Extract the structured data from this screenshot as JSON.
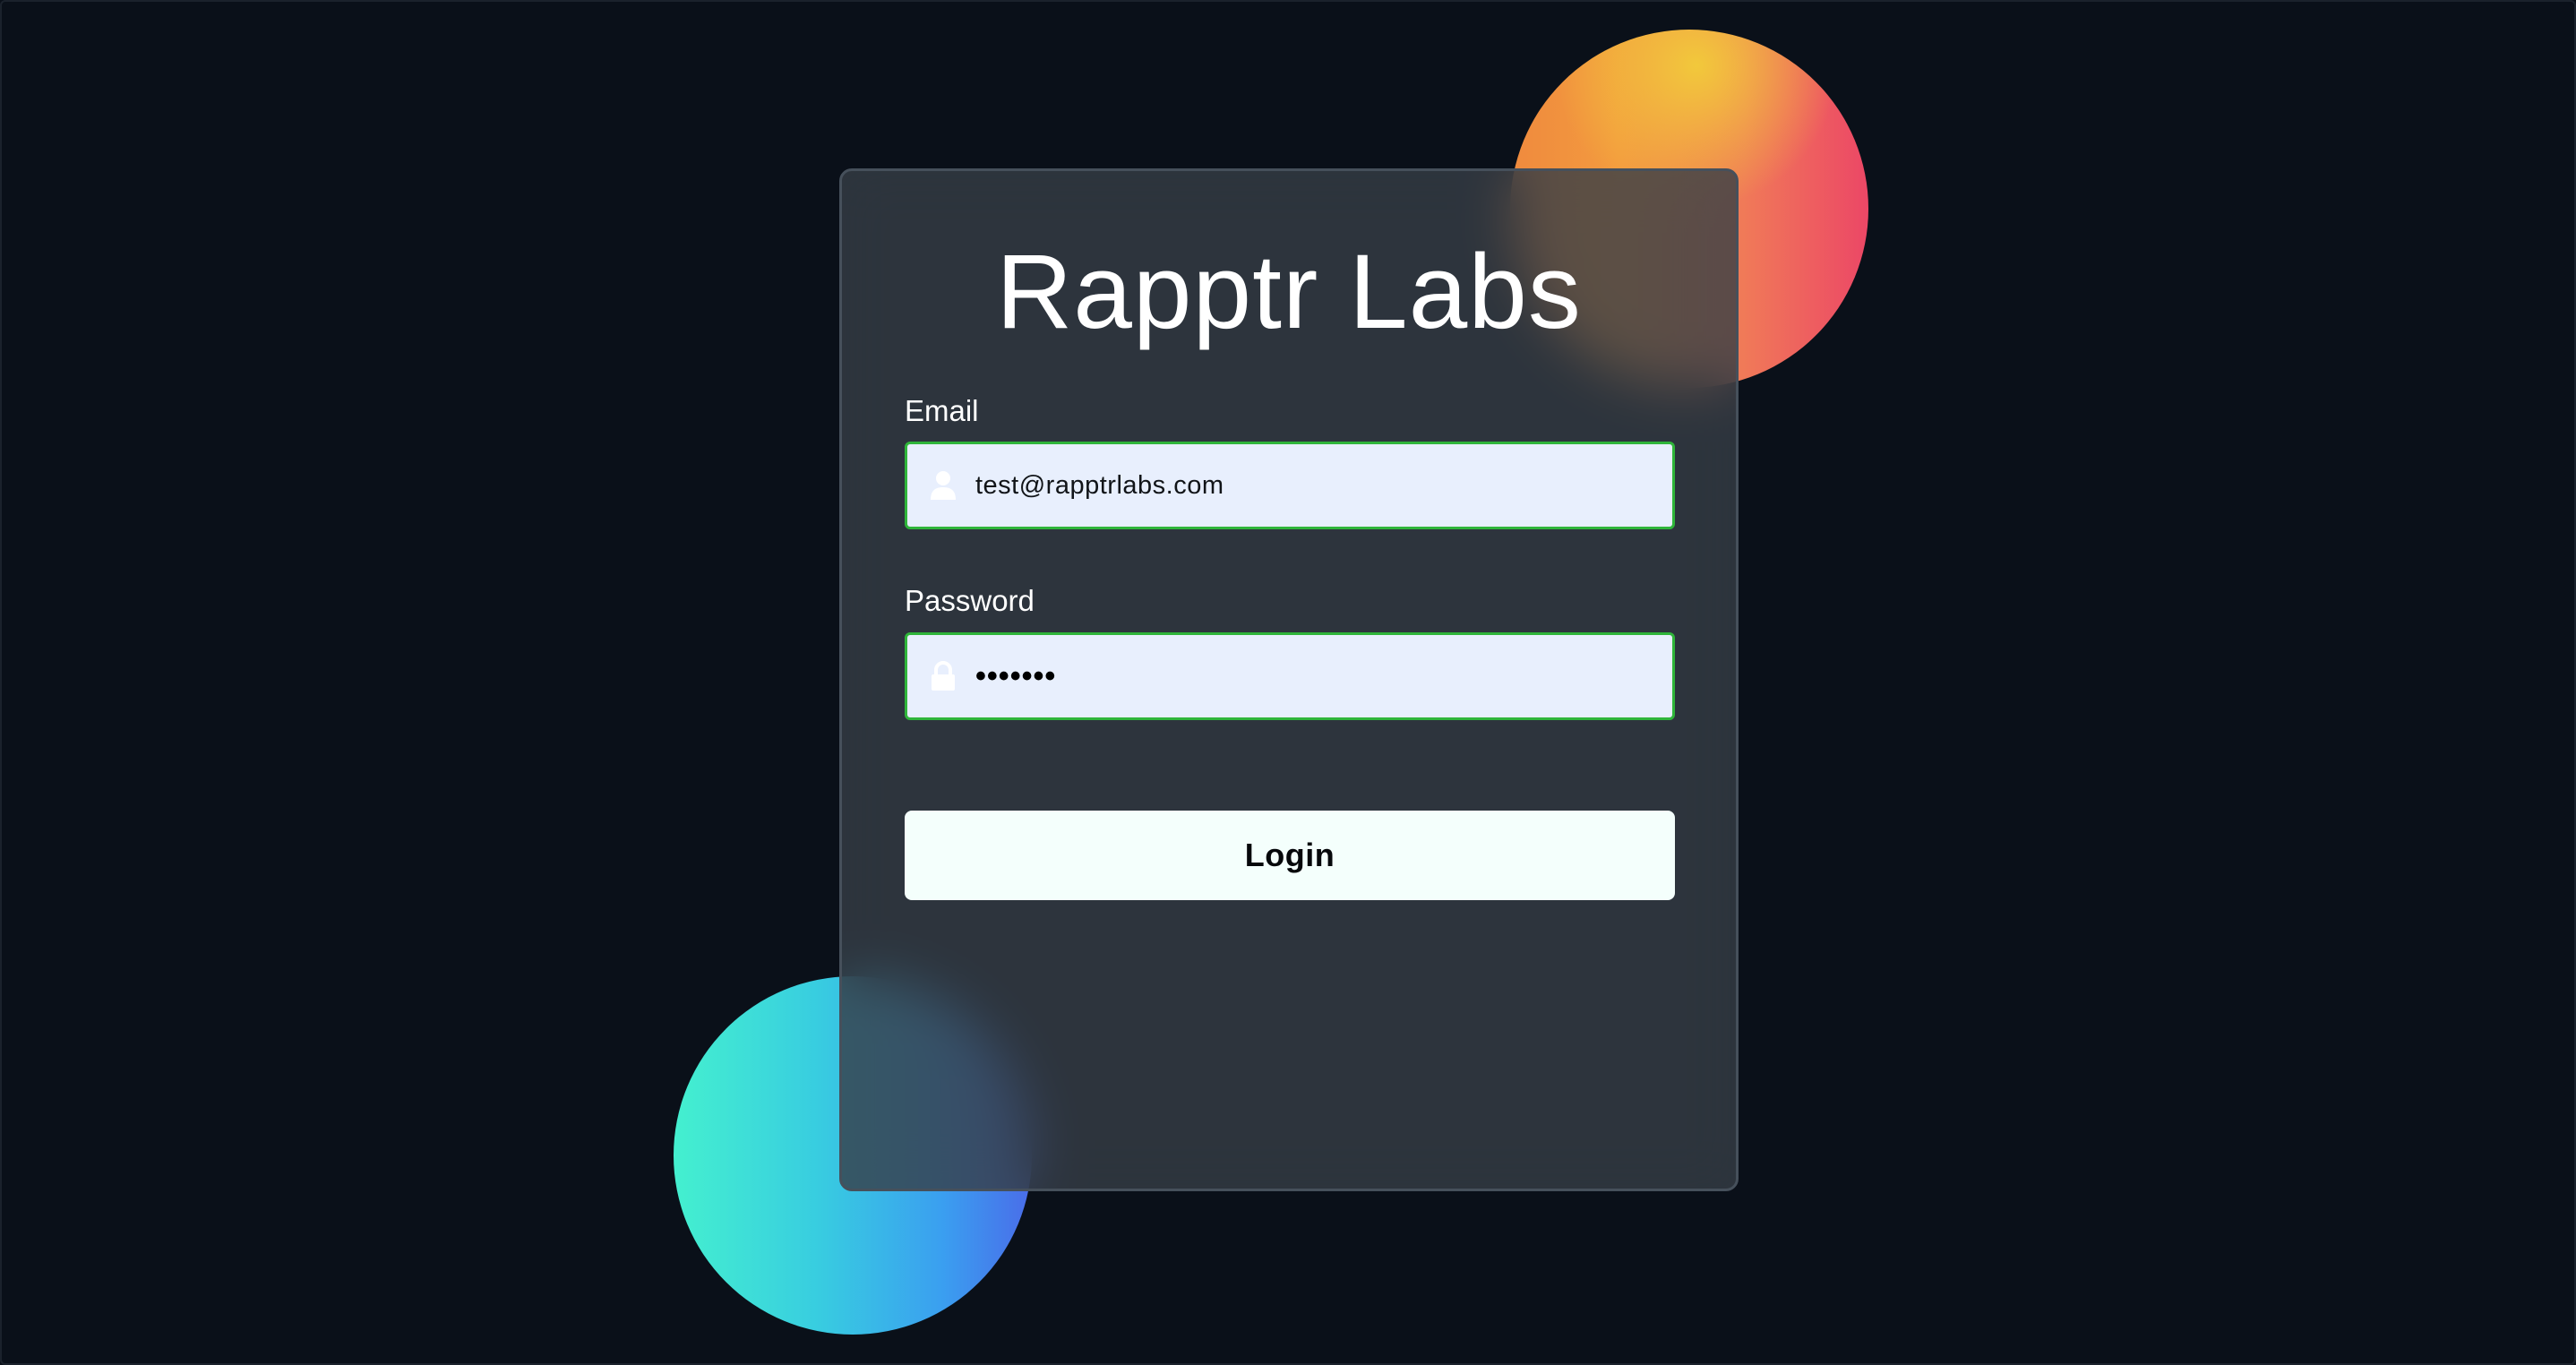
{
  "page": {
    "background": "#0a1019"
  },
  "login_card": {
    "title": "Rapptr Labs",
    "email": {
      "label": "Email",
      "value": "test@rapptrlabs.com",
      "icon": "user-icon"
    },
    "password": {
      "label": "Password",
      "masked_value": "•••••••",
      "icon": "lock-icon"
    },
    "submit_label": "Login"
  },
  "colors": {
    "card_background": "#2d333b",
    "input_background": "#e8effd",
    "input_border": "#2fb53a",
    "button_background": "#f4fffc",
    "warm_blob": [
      "#f2cc3a",
      "#ef8a3e",
      "#ec4766"
    ],
    "cool_blob": [
      "#44f0cf",
      "#3a9ff0",
      "#4a6ce9"
    ]
  }
}
